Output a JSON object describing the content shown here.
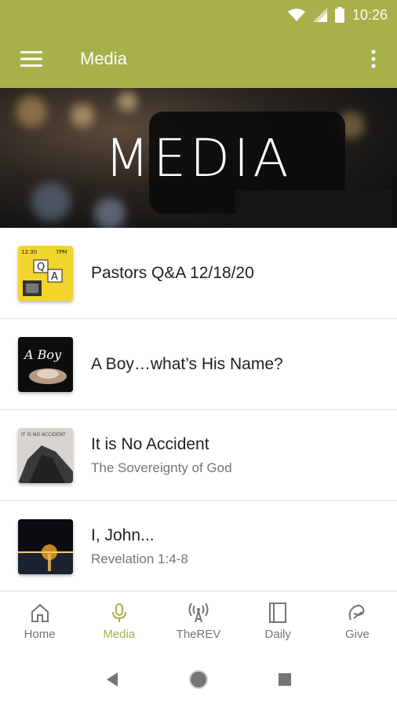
{
  "status_bar": {
    "time": "10:26"
  },
  "app_bar": {
    "title": "Media"
  },
  "hero": {
    "text": "MEDIA"
  },
  "items": [
    {
      "title": "Pastors Q&A 12/18/20",
      "subtitle": ""
    },
    {
      "title": "A Boy…what’s His Name?",
      "subtitle": ""
    },
    {
      "title": "It is No Accident",
      "subtitle": "The Sovereignty of God"
    },
    {
      "title": "I, John...",
      "subtitle": "Revelation 1:4-8"
    }
  ],
  "thumbs": {
    "qa_top_left": "12:30",
    "qa_top_right": "7PM",
    "qa_q": "Q",
    "qa_a": "A",
    "boy_text": "A Boy",
    "accident_text": "IT IS NO ACCIDENT"
  },
  "bottom_nav": [
    {
      "label": "Home",
      "icon": "home-icon"
    },
    {
      "label": "Media",
      "icon": "microphone-icon"
    },
    {
      "label": "TheREV",
      "icon": "broadcast-icon"
    },
    {
      "label": "Daily",
      "icon": "book-icon"
    },
    {
      "label": "Give",
      "icon": "give-icon"
    }
  ],
  "colors": {
    "accent": "#a7b04a"
  }
}
